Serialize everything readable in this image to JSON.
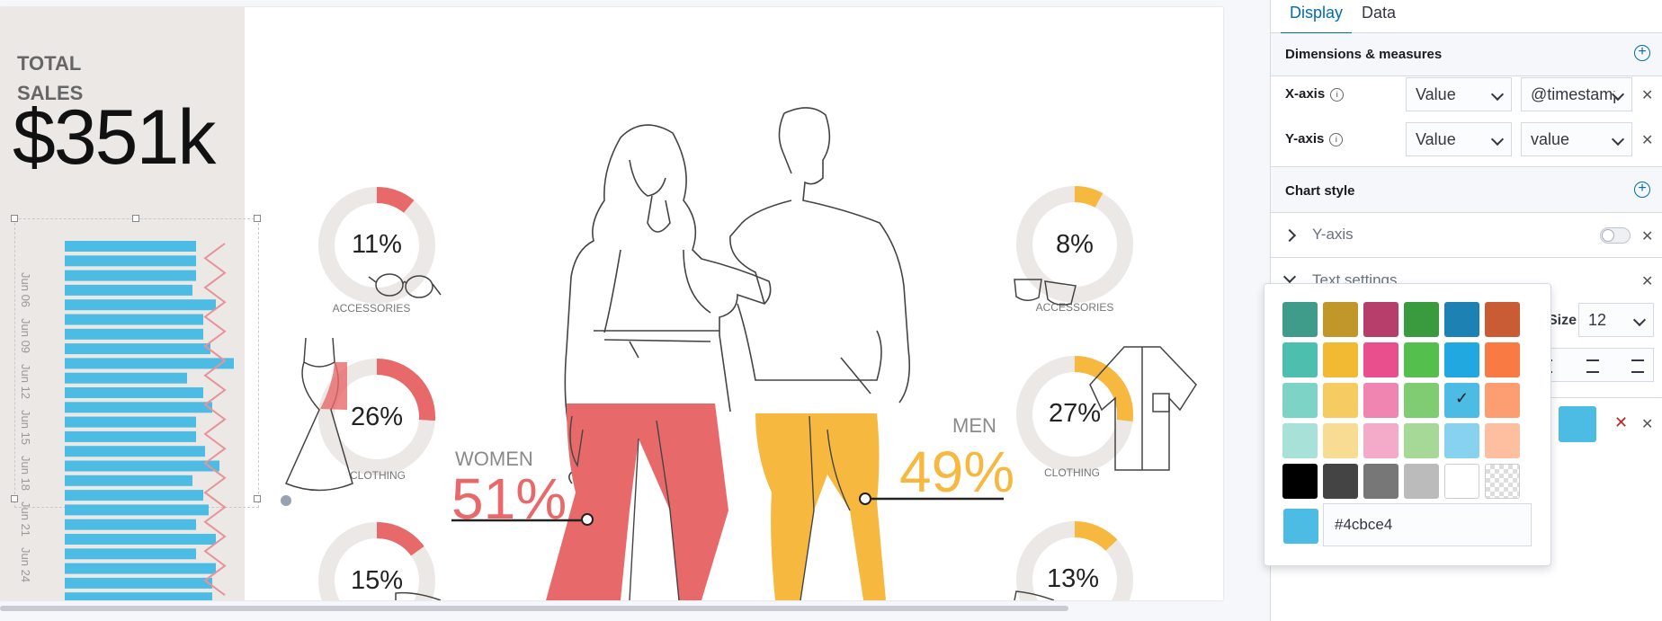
{
  "canvas": {
    "total_label": "TOTAL SALES",
    "total_value": "$351k",
    "bar_chart": {
      "bar_color": "#4cbce4",
      "date_labels": [
        "Jun 06",
        "Jun 09",
        "Jun 12",
        "Jun 15",
        "Jun 18",
        "Jun 21",
        "Jun 24"
      ],
      "bar_values": [
        0.73,
        0.73,
        0.73,
        0.71,
        0.84,
        0.77,
        0.77,
        0.81,
        0.94,
        0.68,
        0.77,
        0.82,
        0.73,
        0.73,
        0.78,
        0.86,
        0.71,
        0.77,
        0.8,
        0.73,
        0.84,
        0.73,
        0.84,
        0.82,
        0.82
      ]
    },
    "donuts_women": [
      {
        "percent_label": "11%",
        "value": 11,
        "category": "ACCESSORIES",
        "color": "#e8696a"
      },
      {
        "percent_label": "26%",
        "value": 26,
        "category": "CLOTHING",
        "color": "#e8696a"
      },
      {
        "percent_label": "15%",
        "value": 15,
        "category": "",
        "color": "#e8696a"
      }
    ],
    "donuts_men": [
      {
        "percent_label": "8%",
        "value": 8,
        "category": "ACCESSORIES",
        "color": "#f7b840"
      },
      {
        "percent_label": "27%",
        "value": 27,
        "category": "CLOTHING",
        "color": "#f7b840"
      },
      {
        "percent_label": "13%",
        "value": 13,
        "category": "",
        "color": "#f7b840"
      }
    ],
    "women": {
      "label": "WOMEN",
      "percent": "51%",
      "color": "#e8696a"
    },
    "men": {
      "label": "MEN",
      "percent": "49%",
      "color": "#f7b840"
    }
  },
  "sidebar": {
    "tabs": [
      "Display",
      "Data"
    ],
    "dimensions_title": "Dimensions & measures",
    "x_axis": {
      "label": "X-axis",
      "type": "Value",
      "field": "@timestamp"
    },
    "y_axis": {
      "label": "Y-axis",
      "type": "Value",
      "field": "value"
    },
    "chart_style_title": "Chart style",
    "y_axis_section": "Y-axis",
    "text_settings": "Text settings",
    "size_label": "Size",
    "size_value": "12",
    "selected_color": "#4cbce4"
  },
  "color_picker": {
    "hex_value": "#4cbce4",
    "swatches": [
      [
        "#3f9b8a",
        "#c2972a",
        "#b73d6b",
        "#3a9a3e",
        "#1d82b3",
        "#c95c34"
      ],
      [
        "#4cbfae",
        "#f2ba33",
        "#e94f8c",
        "#55bf4d",
        "#21a8e0",
        "#fa7a43"
      ],
      [
        "#7dd4c6",
        "#f6cb62",
        "#ef85b0",
        "#80cc72",
        "#4cbce4",
        "#fc9d72"
      ],
      [
        "#a7e1d7",
        "#f8dc93",
        "#f4aac9",
        "#a6d997",
        "#87d2ee",
        "#fdbf9f"
      ],
      [
        "#000000",
        "#444444",
        "#777777",
        "#bbbbbb",
        "#ffffff",
        "transparent"
      ]
    ],
    "selected_index": [
      2,
      4
    ]
  }
}
